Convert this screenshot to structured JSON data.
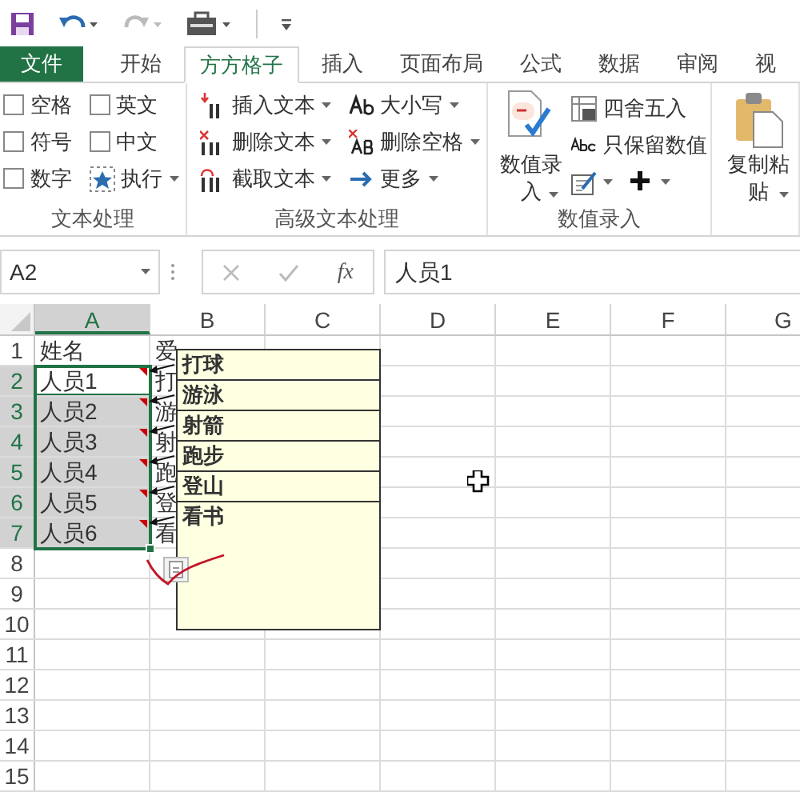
{
  "tabs": [
    {
      "label": "文件",
      "kind": "file",
      "selected": false
    },
    {
      "label": "开始",
      "kind": "tab",
      "selected": false
    },
    {
      "label": "方方格子",
      "kind": "tab",
      "selected": true
    },
    {
      "label": "插入",
      "kind": "tab",
      "selected": false
    },
    {
      "label": "页面布局",
      "kind": "tab",
      "selected": false
    },
    {
      "label": "公式",
      "kind": "tab",
      "selected": false
    },
    {
      "label": "数据",
      "kind": "tab",
      "selected": false
    },
    {
      "label": "审阅",
      "kind": "tab",
      "selected": false
    },
    {
      "label": "视",
      "kind": "tab",
      "selected": false
    }
  ],
  "ribbon": [
    {
      "label": "文本处理",
      "kind": "grid",
      "items": [
        {
          "kind": "checkbox",
          "label": "空格",
          "checked": false
        },
        {
          "kind": "checkbox",
          "label": "符号",
          "checked": false
        },
        {
          "kind": "checkbox",
          "label": "数字",
          "checked": false
        },
        {
          "kind": "checkbox",
          "label": "英文",
          "checked": false
        },
        {
          "kind": "checkbox",
          "label": "中文",
          "checked": false
        },
        {
          "kind": "button",
          "label": "执行",
          "dropdown": true
        }
      ]
    },
    {
      "label": "高级文本处理",
      "kind": "grid",
      "items": [
        {
          "kind": "button",
          "label": "插入文本",
          "dropdown": true
        },
        {
          "kind": "button",
          "label": "删除文本",
          "dropdown": true
        },
        {
          "kind": "button",
          "label": "截取文本",
          "dropdown": true
        },
        {
          "kind": "button",
          "label": "大小写",
          "dropdown": true
        },
        {
          "kind": "button",
          "label": "删除空格",
          "dropdown": true
        },
        {
          "kind": "button",
          "label": "更多",
          "dropdown": true
        }
      ]
    },
    {
      "label": "数值录入",
      "kind": "mixed",
      "items": [
        {
          "kind": "large",
          "label": "数值录入",
          "dropdown": true
        },
        {
          "kind": "button",
          "label": "四舍五入",
          "dropdown": false
        },
        {
          "kind": "button",
          "label": "只保留数值",
          "dropdown": false
        },
        {
          "kind": "icon_button",
          "dropdown": true
        },
        {
          "kind": "icon_button",
          "dropdown": true
        }
      ]
    },
    {
      "kind": "mixed",
      "items": [
        {
          "kind": "large",
          "label": "复制粘贴",
          "dropdown": true
        }
      ]
    }
  ],
  "formula_bar": {
    "name_box": "A2",
    "function_label": "fx",
    "value": "人员1"
  },
  "sheet": {
    "columns": [
      {
        "label": "A",
        "selected": true
      },
      {
        "label": "B",
        "selected": false
      },
      {
        "label": "C",
        "selected": false
      },
      {
        "label": "D",
        "selected": false
      },
      {
        "label": "E",
        "selected": false
      },
      {
        "label": "F",
        "selected": false
      },
      {
        "label": "G",
        "selected": false
      }
    ],
    "rows": [
      {
        "label": "1",
        "selected": false,
        "cells": [
          {
            "text": "姓名",
            "selected": false,
            "active": false,
            "comment": false
          },
          {
            "text": "爱",
            "selected": false,
            "active": false,
            "comment": false
          }
        ]
      },
      {
        "label": "2",
        "selected": true,
        "cells": [
          {
            "text": "人员1",
            "selected": true,
            "active": true,
            "comment": true
          },
          {
            "text": "打",
            "selected": false,
            "active": false,
            "comment": false
          }
        ]
      },
      {
        "label": "3",
        "selected": true,
        "cells": [
          {
            "text": "人员2",
            "selected": true,
            "active": false,
            "comment": true
          },
          {
            "text": "游",
            "selected": false,
            "active": false,
            "comment": false
          }
        ]
      },
      {
        "label": "4",
        "selected": true,
        "cells": [
          {
            "text": "人员3",
            "selected": true,
            "active": false,
            "comment": true
          },
          {
            "text": "射",
            "selected": false,
            "active": false,
            "comment": false
          }
        ]
      },
      {
        "label": "5",
        "selected": true,
        "cells": [
          {
            "text": "人员4",
            "selected": true,
            "active": false,
            "comment": true
          },
          {
            "text": "跑",
            "selected": false,
            "active": false,
            "comment": false
          }
        ]
      },
      {
        "label": "6",
        "selected": true,
        "cells": [
          {
            "text": "人员5",
            "selected": true,
            "active": false,
            "comment": true
          },
          {
            "text": "登",
            "selected": false,
            "active": false,
            "comment": false
          }
        ]
      },
      {
        "label": "7",
        "selected": true,
        "cells": [
          {
            "text": "人员6",
            "selected": true,
            "active": false,
            "comment": true
          },
          {
            "text": "看",
            "selected": false,
            "active": false,
            "comment": false
          }
        ]
      },
      {
        "label": "8",
        "selected": false,
        "cells": []
      },
      {
        "label": "9",
        "selected": false,
        "cells": []
      },
      {
        "label": "10",
        "selected": false,
        "cells": []
      },
      {
        "label": "11",
        "selected": false,
        "cells": []
      },
      {
        "label": "12",
        "selected": false,
        "cells": []
      },
      {
        "label": "13",
        "selected": false,
        "cells": []
      },
      {
        "label": "14",
        "selected": false,
        "cells": []
      },
      {
        "label": "15",
        "selected": false,
        "cells": []
      }
    ]
  },
  "comments": [
    "打球",
    "游泳",
    "射箭",
    "跑步",
    "登山",
    "看书"
  ]
}
